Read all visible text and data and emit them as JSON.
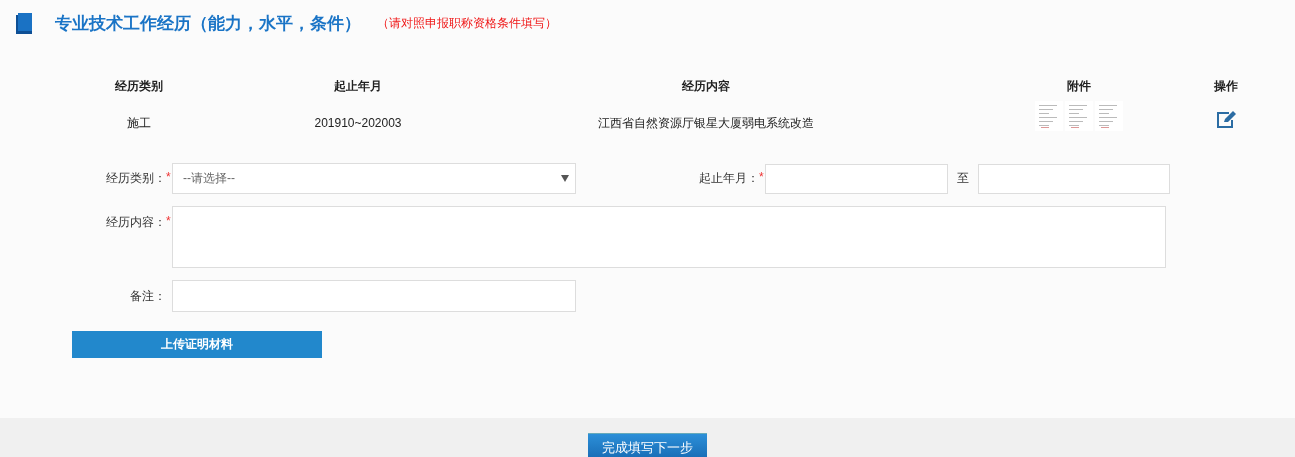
{
  "section": {
    "title": "专业技术工作经历（能力，水平，条件）",
    "note": "（请对照申报职称资格条件填写）"
  },
  "table": {
    "columns": [
      "经历类别",
      "起止年月",
      "经历内容",
      "附件",
      "操作"
    ],
    "rows": [
      {
        "cells": [
          "施工",
          "201910~202003",
          "江西省自然资源厅银星大厦弱电系统改造"
        ]
      }
    ]
  },
  "form": {
    "category": {
      "label": "经历类别：",
      "required_mark": "*",
      "placeholder": "--请选择--"
    },
    "period": {
      "label": "起止年月：",
      "required_mark": "*",
      "separator": "至"
    },
    "content": {
      "label": "经历内容：",
      "required_mark": "*"
    },
    "remark": {
      "label": "备注："
    }
  },
  "upload_button": "上传证明材料",
  "next_button": "完成填写下一步"
}
